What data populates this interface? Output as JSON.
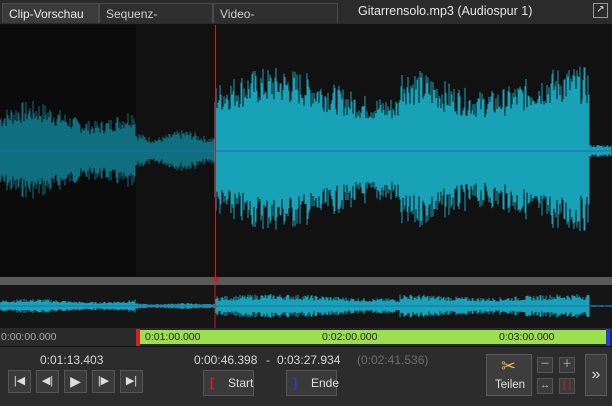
{
  "tabs": [
    {
      "label": "Clip-Vorschau",
      "active": true
    },
    {
      "label": "Sequenz-Vorschau",
      "active": false
    },
    {
      "label": "Video-Anleitungen",
      "active": false,
      "closable": true
    }
  ],
  "file_title": "Gitarrensolo.mp3 (Audiospur 1)",
  "ruler": {
    "labels": [
      "0:00:00.000",
      "0:01:00.000",
      "0:02:00.000",
      "0:03:00.000"
    ]
  },
  "transport": {
    "current_time": "0:01:13.403",
    "selection_start": "0:00:46.398",
    "range_separator": "-",
    "selection_end": "0:03:27.934",
    "selection_length": "(0:02:41.536)",
    "start_label": "Start",
    "end_label": "Ende",
    "split_label": "Teilen",
    "more_label": "»"
  },
  "colors": {
    "waveform": "#17a2b8",
    "waveform_dim": "#0f6f7e",
    "playhead": "#d11a1a",
    "selection": "#9de04d",
    "start_marker": "#d42020",
    "end_marker": "#1f3fd6"
  }
}
